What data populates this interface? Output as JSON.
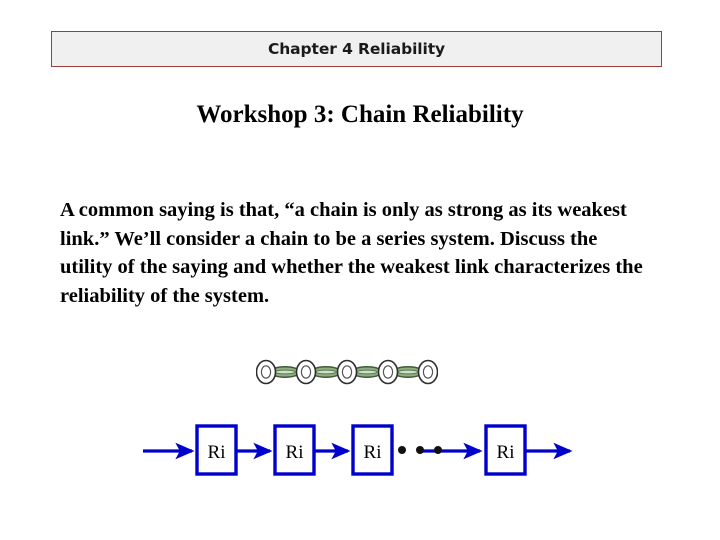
{
  "header": {
    "banner_text": "Chapter 4 Reliability",
    "border_color": "#9e3b3b",
    "fill_color": "#f0f0f0"
  },
  "slide": {
    "title": "Workshop 3: Chain Reliability",
    "body_text": "A common saying is that, “a chain is only as strong as its weakest link.”  We’ll consider a chain to be a series system.  Discuss the utility of the saying and whether the weakest link characterizes the reliability of the system."
  },
  "chain_figure": {
    "name": "chain-illustration",
    "link_fill_color": "#8fae82",
    "link_outline_color": "#3f5a38",
    "link_count": 9
  },
  "series_diagram": {
    "name": "reliability-series-block-diagram",
    "block_color": "#0000cc",
    "arrow_color": "#0000cc",
    "label_color": "#000000",
    "ellipsis_color": "#000000",
    "blocks": [
      {
        "label": "Ri"
      },
      {
        "label": "Ri"
      },
      {
        "label": "Ri"
      },
      {
        "label": "Ri"
      }
    ],
    "ellipsis": "• • •"
  }
}
